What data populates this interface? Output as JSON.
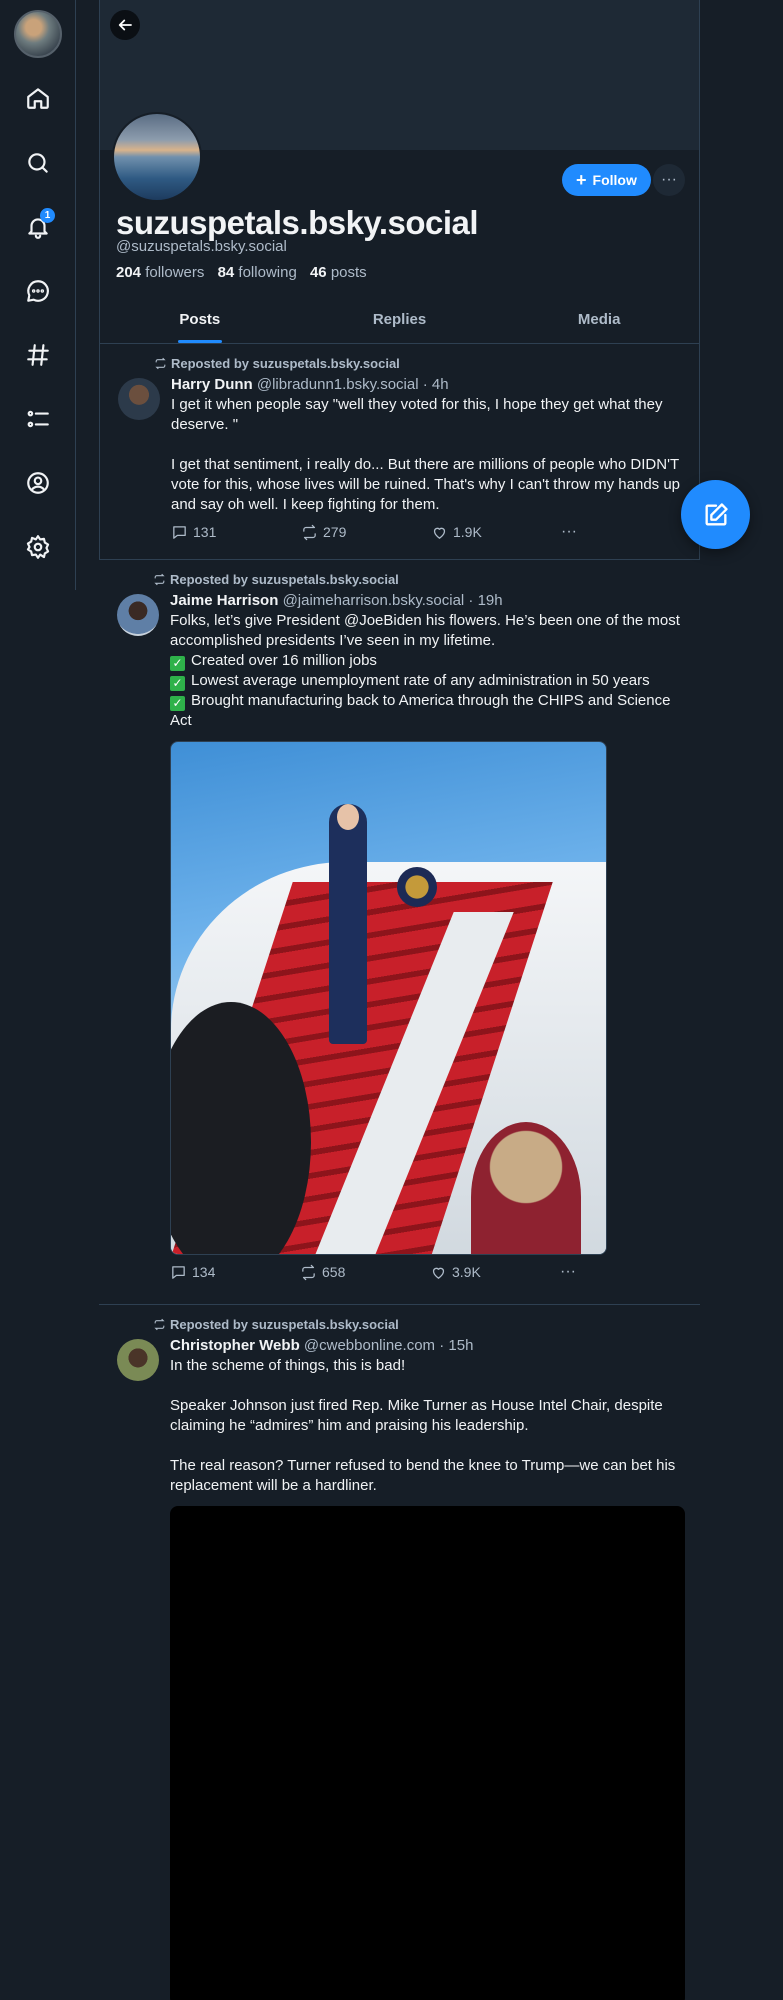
{
  "nav": {
    "notification_count": "1",
    "items": [
      "home-icon",
      "search-icon",
      "bell-icon",
      "chat-icon",
      "hashtag-icon",
      "list-icon",
      "profile-icon",
      "settings-icon"
    ]
  },
  "profile": {
    "display_handle": "suzuspetals.bsky.social",
    "handle": "@suzuspetals.bsky.social",
    "follow_label": "Follow",
    "followers_count": "204",
    "followers_label": "followers",
    "following_count": "84",
    "following_label": "following",
    "posts_count": "46",
    "posts_label": "posts"
  },
  "tabs": [
    {
      "label": "Posts",
      "active": true
    },
    {
      "label": "Replies",
      "active": false
    },
    {
      "label": "Media",
      "active": false
    }
  ],
  "posts": [
    {
      "repost_label": "Reposted by suzuspetals.bsky.social",
      "name": "Harry Dunn",
      "handle": "@libradunn1.bsky.social",
      "time": "· 4h",
      "text": "I get it when people say \"well they voted for this, I hope they get what they deserve. \"\n\nI get that sentiment, i really do... But there are millions of people who DIDN'T vote for this, whose lives will be ruined. That's why I can't throw my hands up and say oh well. I keep fighting for them.",
      "replies": "131",
      "reposts": "279",
      "likes": "1.9K"
    },
    {
      "repost_label": "Reposted by suzuspetals.bsky.social",
      "name": "Jaime Harrison",
      "handle": "@jaimeharrison.bsky.social",
      "time": "· 19h",
      "text_intro": "Folks, let’s give President @JoeBiden his flowers. He’s been one of the most accomplished presidents I’ve seen in my lifetime.",
      "bullets": [
        "Created over 16 million jobs",
        "Lowest average unemployment rate of any administration in 50 years",
        "Brought manufacturing back to America through the CHIPS and Science Act"
      ],
      "replies": "134",
      "reposts": "658",
      "likes": "3.9K"
    },
    {
      "repost_label": "Reposted by suzuspetals.bsky.social",
      "name": "Christopher Webb",
      "handle": "@cwebbonline.com",
      "time": "· 15h",
      "text": "In the scheme of things, this is bad!\n\nSpeaker Johnson just fired Rep. Mike Turner as House Intel Chair, despite claiming he “admires” him and praising his leadership.\n\nThe real reason? Turner refused to bend the knee to Trump—we can bet his replacement will be a hardliner."
    }
  ]
}
